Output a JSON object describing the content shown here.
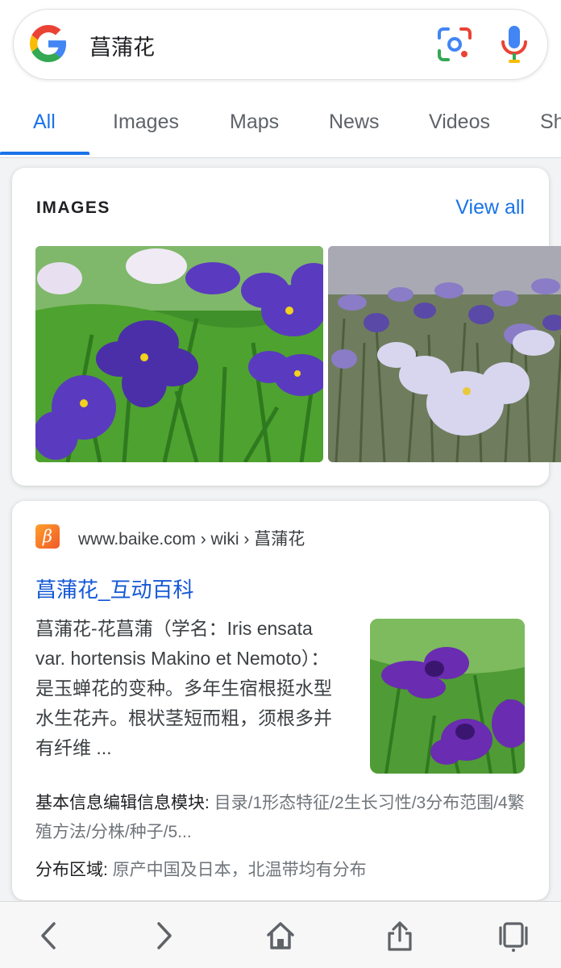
{
  "search": {
    "query": "菖蒲花",
    "icons": [
      "google-logo",
      "lens-icon",
      "mic-icon"
    ]
  },
  "tabs": [
    {
      "label": "All",
      "active": true
    },
    {
      "label": "Images",
      "active": false
    },
    {
      "label": "Maps",
      "active": false
    },
    {
      "label": "News",
      "active": false
    },
    {
      "label": "Videos",
      "active": false
    },
    {
      "label": "Sh",
      "active": false
    }
  ],
  "images_card": {
    "heading": "IMAGES",
    "view_all": "View all",
    "thumbnails": [
      "purple-iris-photo",
      "pale-iris-field-photo"
    ]
  },
  "result": {
    "site_icon_glyph": "β",
    "breadcrumb": "www.baike.com › wiki › 菖蒲花",
    "title": "菖蒲花_互动百科",
    "snippet": "菖蒲花-花菖蒲（学名：Iris ensata var. hortensis Makino et Nemoto）：是玉蝉花的变种。多年生宿根挺水型水生花卉。根状茎短而粗，须根多并有纤维 ...",
    "attr1_label": "基本信息编辑信息模块: ",
    "attr1_value": "目录/1形态特征/2生长习性/3分布范围/4繁殖方法/分株/种子/5...",
    "attr2_label": "分布区域: ",
    "attr2_value": "原产中国及日本，北温带均有分布"
  },
  "colors": {
    "accent": "#1a73e8",
    "link": "#1558d6",
    "google_blue": "#4285F4",
    "google_red": "#EA4335",
    "google_yellow": "#FBBC05",
    "google_green": "#34A853"
  },
  "bottom_nav": [
    "back-icon",
    "forward-icon",
    "home-icon",
    "share-icon",
    "tabs-icon"
  ]
}
